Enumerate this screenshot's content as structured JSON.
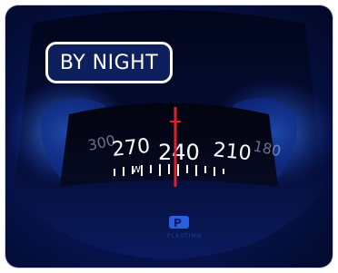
{
  "badge": {
    "label": "BY NIGHT"
  },
  "compass": {
    "scale_numbers": [
      "270",
      "240",
      "210",
      "300",
      "180"
    ],
    "cardinal": "W",
    "brand_text": "PLASTIMO"
  },
  "colors": {
    "background": "#06124a",
    "glow": "#2a6bff",
    "lubber_line": "#e0202a",
    "badge_fill": "#0d1f5c",
    "badge_border": "#ffffff"
  }
}
